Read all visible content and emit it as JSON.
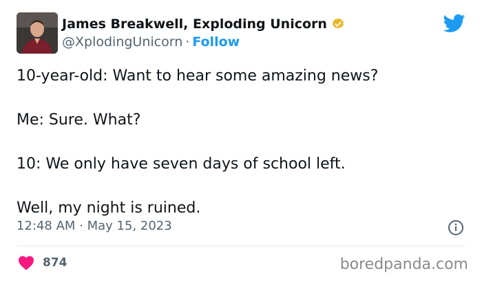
{
  "author": {
    "name": "James Breakwell, Exploding Unicorn",
    "handle": "@XplodingUnicorn",
    "separator": "·",
    "follow_label": "Follow"
  },
  "tweet": {
    "lines": [
      "10-year-old: Want to hear some amazing news?",
      "Me: Sure. What?",
      "10: We only have seven days of school left.",
      "Well, my night is ruined."
    ],
    "timestamp": "12:48 AM · May 15, 2023",
    "like_count": "874"
  },
  "watermark": "boredpanda.com",
  "colors": {
    "accent": "#1d9bf0",
    "like": "#f91880",
    "verified": "#e8b829",
    "muted": "#536471"
  },
  "icons": [
    "verified-badge-icon",
    "twitter-bird-icon",
    "info-icon",
    "heart-icon"
  ]
}
